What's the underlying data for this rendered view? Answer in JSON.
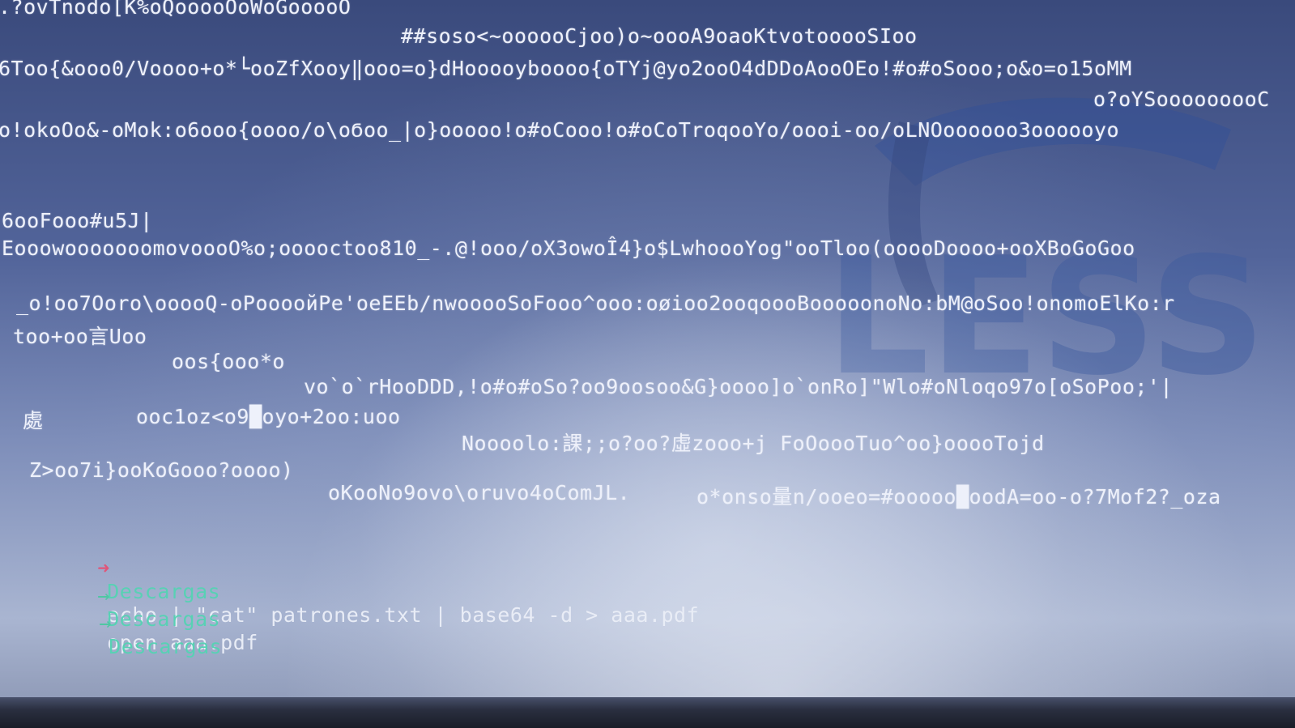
{
  "terminal": {
    "garbage_lines": [
      ".?ovTnodo[K%oQooooOoWoGooooO",
      "##soso<~oooooCjoo)o~oooA9oaoKtvotooooSIoo",
      "6Too{&ooo0/Voooo+o*└ooZfXooy‖ooo=o}dHooooyboooo{oTYj@yo2ooO4dDDoAooOEo!#o#oSooo;o&o=o15oMM",
      "o?oYSooooooooC",
      "o!okoOo&-oMok:o6ooo{oooo/o\\oϬoo_|o}ooooo!o#oCooo!o#oCoTroqooYo/oooi-oo/oLNOoooooo3oooooyo",
      "6ooFooo#u5J|",
      "EooowooooooomovoooO%o;ooooctoo810_-.@!ooo/oX3owoÎ4}o$LwhoooYog\"ooTloo(ooooDoooo+ooXBoGoGoo",
      "_o!oo7Oorо\\ooooQ-oPooooйPe'oeEEb/nwooooSoFooo^ooo:oøioo2ooqoooBooooonoNo:bM@oSoo!onomoElKo:r",
      "too+oo言Uoo",
      "oos{ooo*o",
      "vo`o`rHooDDD,!o#o#oSo?oo9oosoo&G}oooo]o`onRo]\"Wlo#oNloqo97o[oSoPoo;'|",
      "處",
      "ooc1oz<o9█oyo+2oo:uoo",
      "Noooolo:課;;o?oo?虛zooo+j FoOoooTuo^oo}ooooTojd",
      "Z>oo7i}ooKoGooo?oooo)",
      "oKooNo9ovo\\oruvo4oComJL.",
      "o*onso量n/ooeo=#ooooo█oodA=oo-o?7Mof2?_oza"
    ],
    "prompt_lines": [
      {
        "arrow": "➜",
        "dir": "Descargas",
        "command": "echo | \"cat\" patrones.txt | base64 -d > aaa.pdf"
      },
      {
        "arrow": "→",
        "dir": "Descargas",
        "command": "open aaa.pdf"
      },
      {
        "arrow": "→",
        "dir": "Descargas",
        "command": ""
      }
    ]
  },
  "wallpaper": {
    "logo_text": "LESS",
    "logo_color": "#3d5a9e"
  },
  "colors": {
    "prompt_arrow_error": "#e0567a",
    "prompt_arrow_ok": "#4fc7a2",
    "prompt_dir": "#58d1b4",
    "text": "#eef1fb"
  }
}
